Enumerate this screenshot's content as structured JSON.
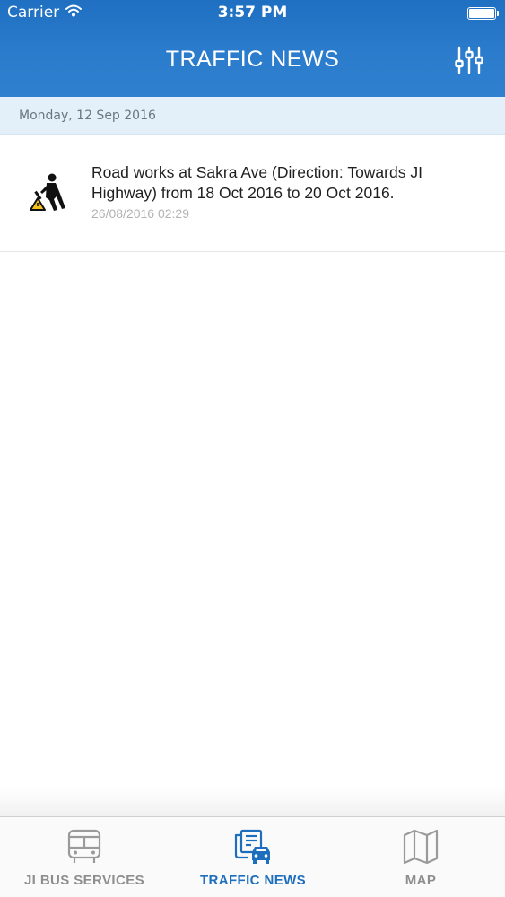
{
  "status_bar": {
    "carrier": "Carrier",
    "time": "3:57 PM"
  },
  "header": {
    "title": "TRAFFIC NEWS"
  },
  "date_header": "Monday, 12 Sep 2016",
  "news_items": [
    {
      "text": "Road works at Sakra Ave (Direction: Towards JI Highway) from 18 Oct 2016 to 20 Oct 2016.",
      "timestamp": "26/08/2016 02:29",
      "icon": "roadworks-icon"
    }
  ],
  "tabs": [
    {
      "label": "JI BUS SERVICES",
      "icon": "bus-icon",
      "active": false
    },
    {
      "label": "TRAFFIC NEWS",
      "icon": "traffic-news-icon",
      "active": true
    },
    {
      "label": "MAP",
      "icon": "map-icon",
      "active": false
    }
  ],
  "colors": {
    "header": "#2b7ccc",
    "active_tab": "#1d6fbd",
    "inactive_tab": "#8e8e8e",
    "date_bar": "#e4f0f9"
  }
}
